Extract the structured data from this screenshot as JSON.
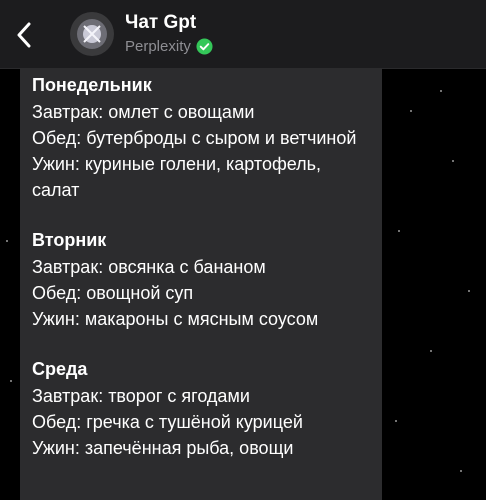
{
  "header": {
    "back_icon": "chevron-left-icon",
    "title": "Чат Gpt",
    "subtitle": "Perplexity",
    "verified_icon": "verified-badge-icon",
    "verified_color": "#34c759"
  },
  "message": {
    "days": [
      {
        "name": "Понедельник",
        "meals": [
          "Завтрак: омлет с овощами",
          "Обед: бутерброды с сыром и ветчиной",
          "Ужин: куриные голени, картофель, салат"
        ]
      },
      {
        "name": "Вторник",
        "meals": [
          "Завтрак: овсянка с бананом",
          "Обед: овощной суп",
          "Ужин: макароны с мясным соусом"
        ]
      },
      {
        "name": "Среда",
        "meals": [
          "Завтрак: творог с ягодами",
          "Обед: гречка с тушёной курицей",
          "Ужин: запечённая рыба, овощи"
        ]
      }
    ]
  }
}
